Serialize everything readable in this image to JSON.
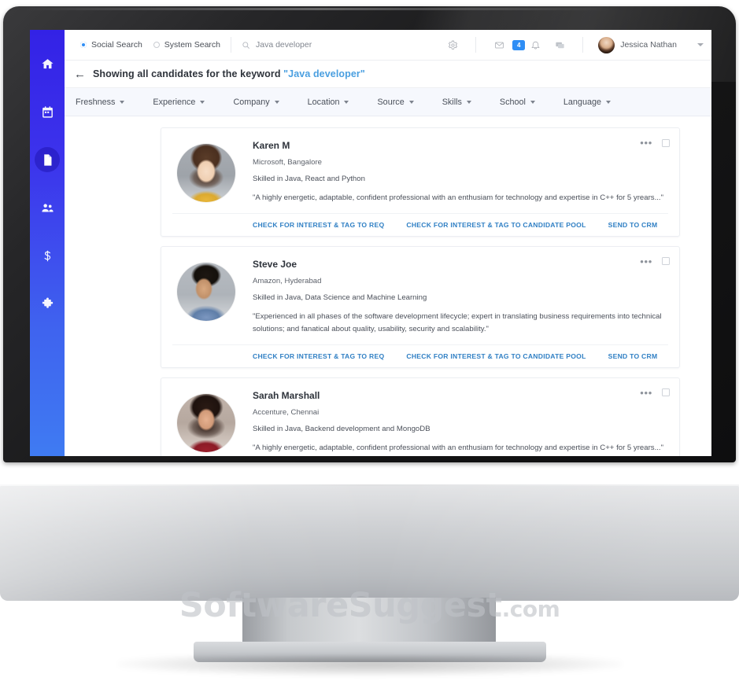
{
  "brand": {
    "accent": "#2f8ef5",
    "rail_top": "#3322e6",
    "rail_bottom": "#3f7bf2",
    "link": "#2f7fc4"
  },
  "watermark": {
    "text": "SoftwareSuggest",
    "suffix": ".com"
  },
  "sidebar": {
    "items": [
      {
        "name": "home",
        "icon": "home-icon",
        "active": false
      },
      {
        "name": "calendar",
        "icon": "calendar-icon",
        "active": false
      },
      {
        "name": "documents",
        "icon": "document-icon",
        "active": true
      },
      {
        "name": "candidates",
        "icon": "people-icon",
        "active": false
      },
      {
        "name": "billing",
        "icon": "dollar-icon",
        "active": false
      },
      {
        "name": "integrations",
        "icon": "puzzle-icon",
        "active": false
      }
    ]
  },
  "topbar": {
    "search_modes": [
      {
        "label": "Social Search",
        "selected": true
      },
      {
        "label": "System Search",
        "selected": false
      }
    ],
    "search": {
      "icon": "search-icon",
      "value": "Java developer",
      "placeholder": "Search"
    },
    "icons": [
      {
        "name": "gear-icon",
        "label": "Settings"
      },
      {
        "name": "mail-icon",
        "label": "Mail"
      },
      {
        "name": "bell-icon",
        "label": "Notifications"
      },
      {
        "name": "chat-icon",
        "label": "Messages"
      }
    ],
    "notification_count": "4",
    "user": {
      "name": "Jessica Nathan",
      "avatar": "user-avatar"
    }
  },
  "heading": {
    "back_icon": "back-arrow-icon",
    "prefix": "Showing all candidates for the keyword ",
    "keyword": "\"Java developer\""
  },
  "filters": [
    {
      "label": "Freshness"
    },
    {
      "label": "Experience"
    },
    {
      "label": "Company"
    },
    {
      "label": "Location"
    },
    {
      "label": "Source"
    },
    {
      "label": "Skills"
    },
    {
      "label": "School"
    },
    {
      "label": "Language"
    }
  ],
  "actions": {
    "tag_to_req": "CHECK FOR INTEREST & TAG TO REQ",
    "tag_to_pool": "CHECK FOR INTEREST & TAG TO CANDIDATE POOL",
    "send_to_crm": "SEND TO CRM"
  },
  "candidates": [
    {
      "name": "Karen M",
      "company": "Microsoft,  Bangalore",
      "skills": "Skilled in Java, React and Python",
      "quote": "\"A highly energetic, adaptable, confident professional with an enthusiam for technology and expertise in C++ for 5 yrears...\"",
      "avatar": "av-karen"
    },
    {
      "name": "Steve Joe",
      "company": "Amazon, Hyderabad",
      "skills": "Skilled in Java, Data Science and Machine Learning",
      "quote": "\"Experienced in all phases of the software development lifecycle; expert in translating business requirements into technical solutions; and fanatical about quality, usability, security and scalability.\"",
      "avatar": "av-steve"
    },
    {
      "name": "Sarah Marshall",
      "company": "Accenture, Chennai",
      "skills": "Skilled in Java, Backend development and MongoDB",
      "quote": "\"A highly energetic, adaptable, confident professional with an enthusiam for technology and expertise in C++ for 5 yrears...\"",
      "avatar": "av-sarah"
    }
  ]
}
